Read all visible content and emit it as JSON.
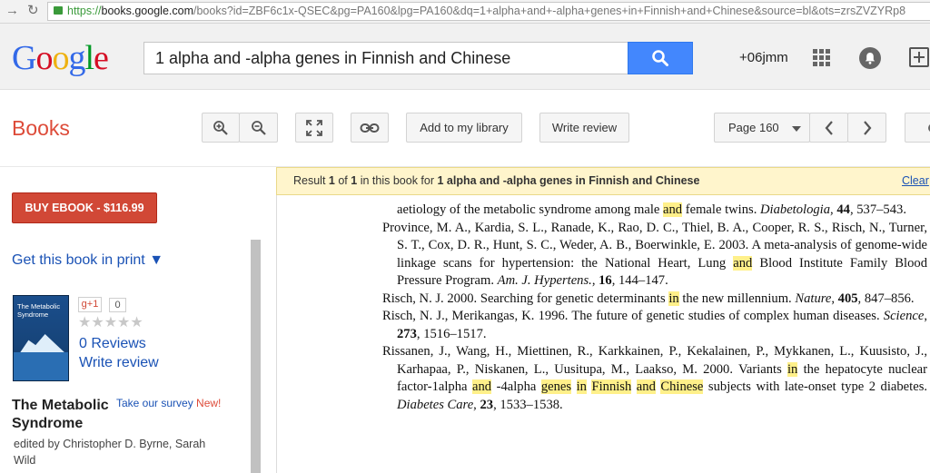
{
  "browser": {
    "url_scheme": "https://",
    "url_host": "books.google.com",
    "url_path": "/books?id=ZBF6c1x-QSEC&pg=PA160&lpg=PA160&dq=1+alpha+and+-alpha+genes+in+Finnish+and+Chinese&source=bl&ots=zrsZVZYRp8"
  },
  "header": {
    "logo_letters": [
      {
        "ch": "G",
        "color": "#3369e8"
      },
      {
        "ch": "o",
        "color": "#d50f25"
      },
      {
        "ch": "o",
        "color": "#eeb211"
      },
      {
        "ch": "g",
        "color": "#3369e8"
      },
      {
        "ch": "l",
        "color": "#009925"
      },
      {
        "ch": "e",
        "color": "#d50f25"
      }
    ],
    "search_query": "1 alpha and -alpha genes in Finnish and Chinese",
    "account": "+06jmm"
  },
  "toolbar": {
    "section_title": "Books",
    "add_library_label": "Add to my library",
    "write_review_label": "Write review",
    "page_label": "Page 160"
  },
  "sidebar": {
    "buy_label": "BUY EBOOK - $116.99",
    "get_print_label": "Get this book in print ▼",
    "cover_title": "The Metabolic Syndrome",
    "gplus_label": "g+1",
    "gplus_count": "0",
    "reviews_label": "0 Reviews",
    "write_review_label": "Write review",
    "book_title": "The Metabolic Syndrome",
    "survey_label": "Take our survey",
    "survey_new": "New!",
    "editors": "edited by Christopher D. Byrne, Sarah Wild"
  },
  "result_bar": {
    "prefix": "Result",
    "index": "1",
    "of": "of",
    "total": "1",
    "middle": "in this book for",
    "query": "1 alpha and -alpha genes in Finnish and Chinese",
    "clear_label": "Clear"
  },
  "references": [
    [
      {
        "t": "aetiology of the metabolic syndrome among male "
      },
      {
        "t": "and",
        "h": true
      },
      {
        "t": " female twins. "
      },
      {
        "t": "Diabetologia",
        "i": true
      },
      {
        "t": ", "
      },
      {
        "t": "44",
        "b": true
      },
      {
        "t": ", 537–543."
      }
    ],
    [
      {
        "t": "Province, M. A., Kardia, S. L., Ranade, K., Rao, D. C., Thiel, B. A., Cooper, R. S., Risch, N., Turner, S. T., Cox, D. R., Hunt, S. C., Weder, A. B., Boerwinkle, E. 2003. A meta-analysis of genome-wide linkage scans for hypertension: the National Heart, Lung "
      },
      {
        "t": "and",
        "h": true
      },
      {
        "t": " Blood Institute Family Blood Pressure Program. "
      },
      {
        "t": "Am. J. Hypertens.",
        "i": true
      },
      {
        "t": ", "
      },
      {
        "t": "16",
        "b": true
      },
      {
        "t": ", 144–147."
      }
    ],
    [
      {
        "t": "Risch, N. J. 2000. Searching for genetic determinants "
      },
      {
        "t": "in",
        "h": true
      },
      {
        "t": " the new millennium. "
      },
      {
        "t": "Nature",
        "i": true
      },
      {
        "t": ", "
      },
      {
        "t": "405",
        "b": true
      },
      {
        "t": ", 847–856."
      }
    ],
    [
      {
        "t": "Risch, N. J., Merikangas, K. 1996. The future of genetic studies of complex human diseases. "
      },
      {
        "t": "Science",
        "i": true
      },
      {
        "t": ", "
      },
      {
        "t": "273",
        "b": true
      },
      {
        "t": ", 1516–1517."
      }
    ],
    [
      {
        "t": "Rissanen, J., Wang, H., Miettinen, R., Karkkainen, P., Kekalainen, P., Mykkanen, L., Kuusisto, J., Karhapaa, P., Niskanen, L., Uusitupa, M., Laakso, M. 2000. Variants "
      },
      {
        "t": "in",
        "h": true
      },
      {
        "t": " the hepatocyte nuclear factor-1alpha "
      },
      {
        "t": "and",
        "h": true
      },
      {
        "t": " -4alpha "
      },
      {
        "t": "genes",
        "h": true
      },
      {
        "t": " "
      },
      {
        "t": "in",
        "h": true
      },
      {
        "t": " "
      },
      {
        "t": "Finnish",
        "h": true
      },
      {
        "t": " "
      },
      {
        "t": "and",
        "h": true
      },
      {
        "t": " "
      },
      {
        "t": "Chinese",
        "h": true
      },
      {
        "t": " subjects with late-onset type 2 diabetes. "
      },
      {
        "t": "Diabetes Care",
        "i": true
      },
      {
        "t": ", "
      },
      {
        "t": "23",
        "b": true
      },
      {
        "t": ", 1533–1538."
      }
    ]
  ]
}
